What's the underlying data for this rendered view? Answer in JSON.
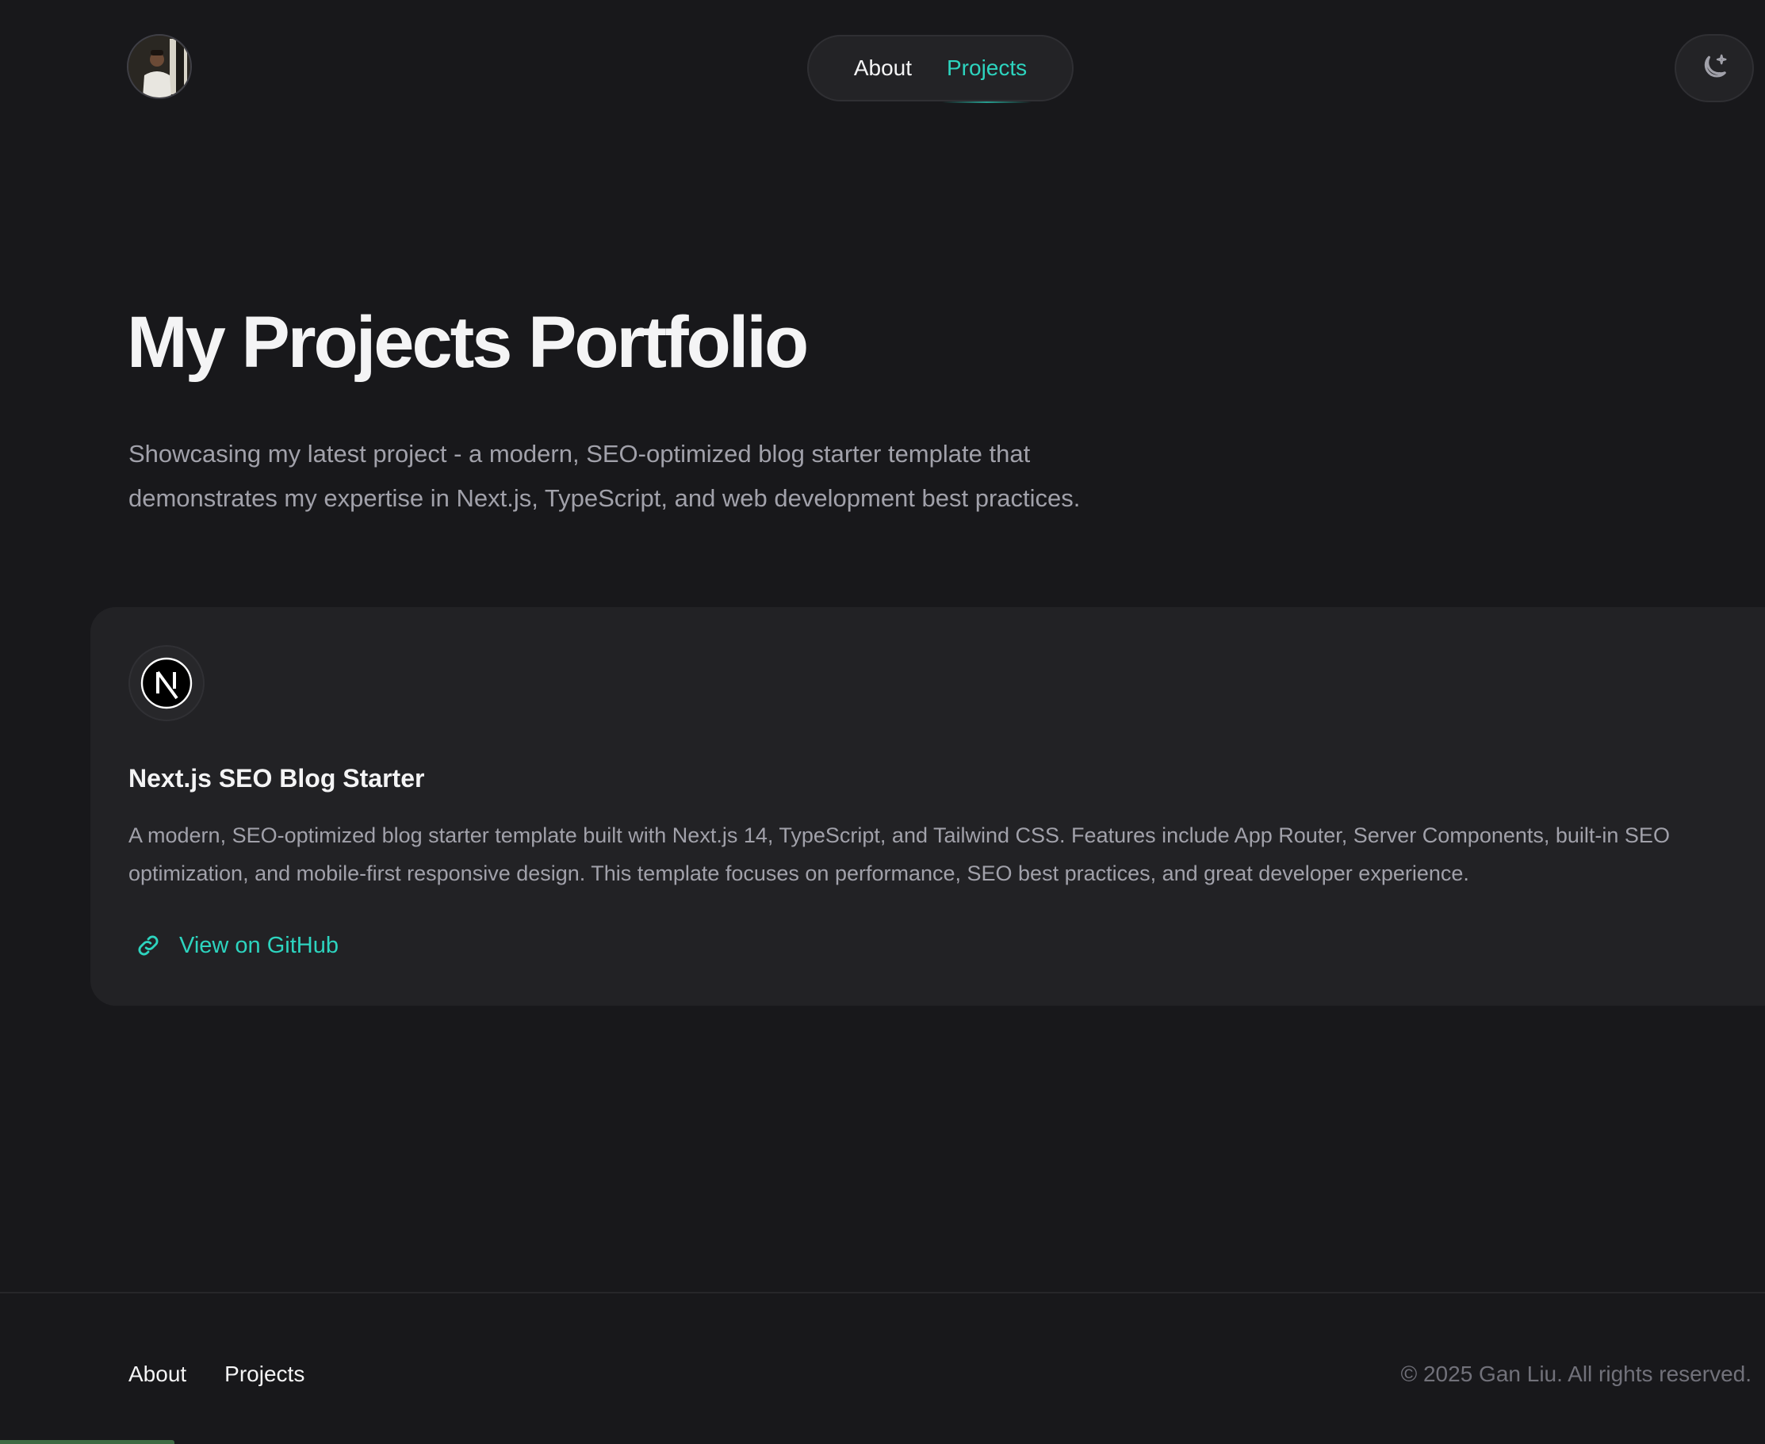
{
  "header": {
    "nav": [
      {
        "label": "About"
      },
      {
        "label": "Projects"
      }
    ],
    "active_nav": "Projects",
    "theme_icon": "moon-sparkle-icon"
  },
  "hero": {
    "title": "My Projects Portfolio",
    "subtitle": "Showcasing my latest project - a modern, SEO-optimized blog starter template that demonstrates my expertise in Next.js, TypeScript, and web development best practices."
  },
  "projects": [
    {
      "logo_icon": "nextjs-logo-icon",
      "title": "Next.js SEO Blog Starter",
      "description": "A modern, SEO-optimized blog starter template built with Next.js 14, TypeScript, and Tailwind CSS. Features include App Router, Server Components, built-in SEO optimization, and mobile-first responsive design. This template focuses on performance, SEO best practices, and great developer experience.",
      "link_label": "View on GitHub",
      "link_icon": "link-icon"
    }
  ],
  "footer": {
    "nav": [
      {
        "label": "About"
      },
      {
        "label": "Projects"
      }
    ],
    "copyright": "© 2025 Gan Liu. All rights reserved."
  },
  "colors": {
    "background": "#18181b",
    "card": "#222225",
    "accent": "#2dd4bf",
    "text_primary": "#f4f4f5",
    "text_muted": "#a1a1aa"
  }
}
